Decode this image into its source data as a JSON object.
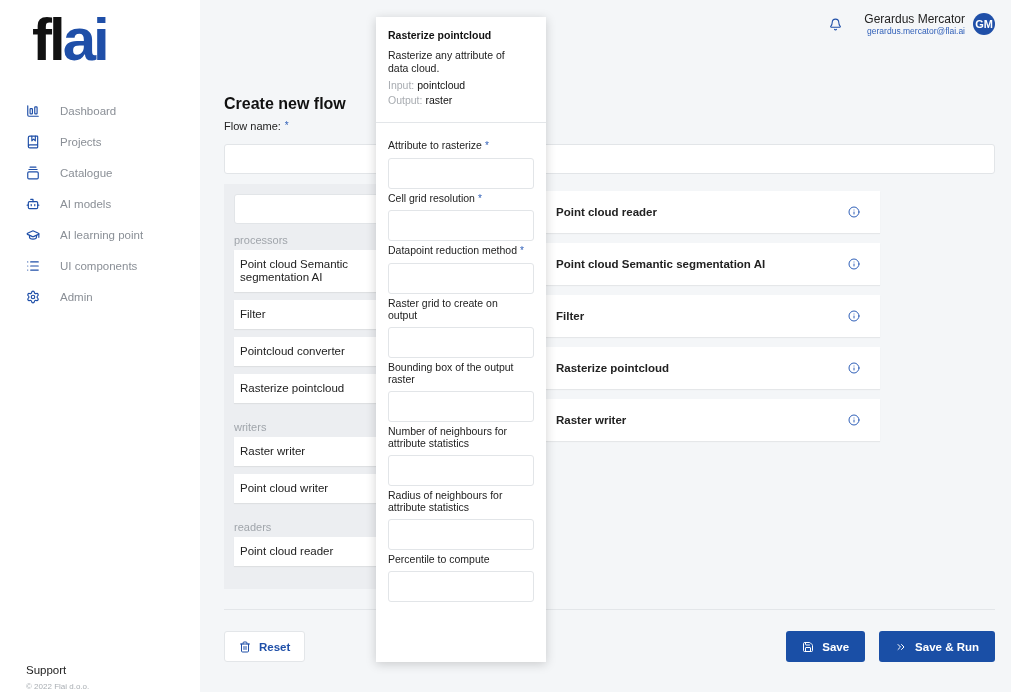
{
  "logo": {
    "dark": "fl",
    "accent": "ai"
  },
  "sidebar": {
    "items": [
      {
        "label": "Dashboard",
        "kind": "dashboard"
      },
      {
        "label": "Projects",
        "kind": "projects"
      },
      {
        "label": "Catalogue",
        "kind": "catalogue"
      },
      {
        "label": "AI models",
        "kind": "models"
      },
      {
        "label": "AI learning point",
        "kind": "learning"
      },
      {
        "label": "UI components",
        "kind": "components"
      },
      {
        "label": "Admin",
        "kind": "admin"
      }
    ],
    "support": "Support",
    "copyright": "© 2022 Flai d.o.o."
  },
  "user": {
    "name": "Gerardus Mercator",
    "email": "gerardus.mercator@flai.ai",
    "initials": "GM"
  },
  "title": "Create new flow",
  "flow_name": {
    "label": "Flow name:",
    "required_mark": "*"
  },
  "palette": {
    "groups": [
      {
        "name": "processors",
        "items": [
          "Point cloud Semantic segmentation AI",
          "Filter",
          "Pointcloud converter",
          "Rasterize pointcloud"
        ]
      },
      {
        "name": "writers",
        "items": [
          "Raster writer",
          "Point cloud writer"
        ]
      },
      {
        "name": "readers",
        "items": [
          "Point cloud reader"
        ]
      }
    ]
  },
  "flow_steps": [
    "Point cloud reader",
    "Point cloud Semantic segmentation AI",
    "Filter",
    "Rasterize pointcloud",
    "Raster writer"
  ],
  "popover": {
    "title": "Rasterize pointcloud",
    "description": "Rasterize any attribute of data cloud.",
    "io": [
      {
        "label": "Input:",
        "value": "pointcloud"
      },
      {
        "label": "Output:",
        "value": "raster"
      }
    ],
    "fields": [
      {
        "label": "Attribute to rasterize",
        "required_mark": "*"
      },
      {
        "label": "Cell grid resolution",
        "required_mark": "*"
      },
      {
        "label": "Datapoint reduction method",
        "required_mark": "*"
      },
      {
        "label": "Raster grid to create on output"
      },
      {
        "label": "Bounding box of the output raster"
      },
      {
        "label": "Number of neighbours for attribute statistics"
      },
      {
        "label": "Radius of neighbours for attribute statistics"
      },
      {
        "label": "Percentile to compute"
      }
    ]
  },
  "buttons": {
    "reset": "Reset",
    "save": "Save",
    "save_run": "Save & Run"
  }
}
